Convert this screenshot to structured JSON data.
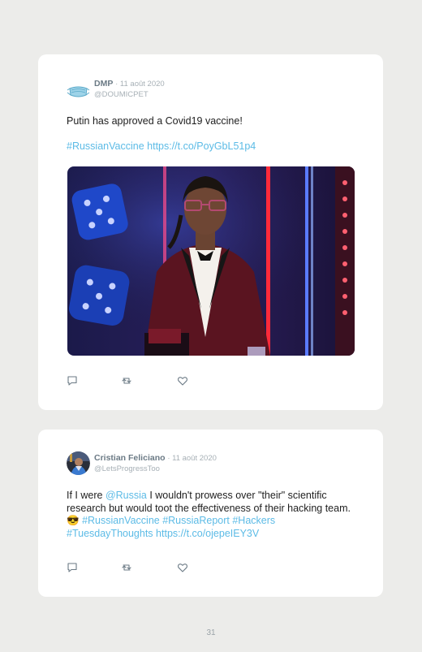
{
  "tweets": [
    {
      "author_name": "DMP",
      "date": "· 11 août 2020",
      "handle": "@DOUMICPET",
      "text_line1": "Putin has approved a Covid19 vaccine!",
      "hashtag": "#RussianVaccine",
      "url": "https://t.co/PoyGbL51p4",
      "avatar_icon": "medical-mask-icon"
    },
    {
      "author_name": "Cristian Feliciano",
      "date": "· 11 août 2020",
      "handle": "@LetsProgressToo",
      "text_pre_mention": "If I were ",
      "mention": "@Russia",
      "text_after_mention": " I wouldn't prowess over \"their\" scientific research but would toot the effectiveness of their hacking team.",
      "emoji": "😎",
      "hashtags": "#RussianVaccine #RussiaReport #Hackers #TuesdayThoughts",
      "url": "https://t.co/ojepeIEY3V",
      "avatar_icon": "profile-photo-icon"
    }
  ],
  "action_icons": [
    "reply-icon",
    "retweet-icon",
    "like-icon"
  ],
  "colors": {
    "link": "#5cbbe6",
    "card": "#ffffff",
    "background": "#ececea"
  },
  "page_number": "31"
}
